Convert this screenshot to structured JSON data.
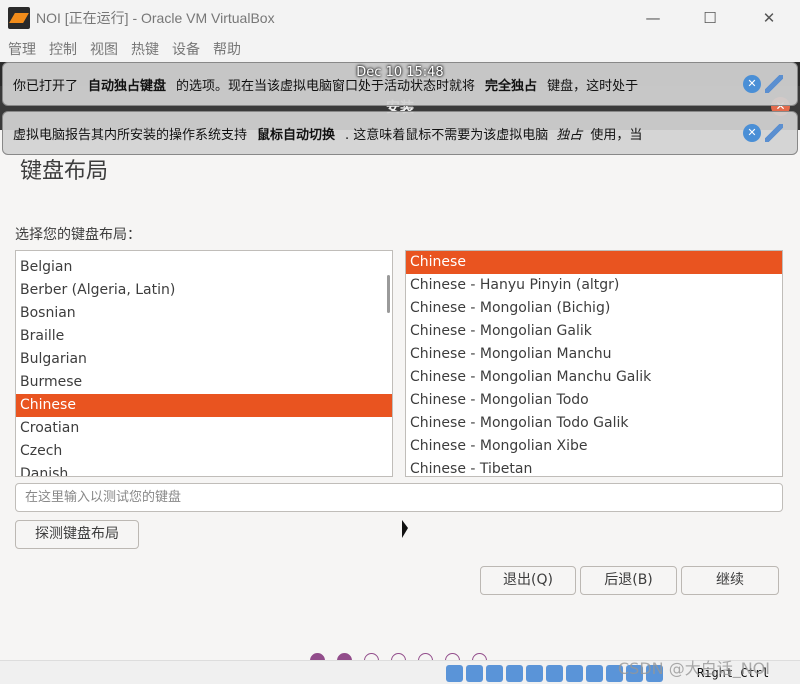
{
  "window": {
    "title": "NOI [正在运行] - Oracle VM VirtualBox",
    "minimize": "—",
    "maximize": "☐",
    "close": "✕"
  },
  "menu": [
    "管理",
    "控制",
    "视图",
    "热键",
    "设备",
    "帮助"
  ],
  "guest": {
    "clock": "Dec 10  15:48",
    "installer_title": "安装"
  },
  "notifications": [
    {
      "pre": "你已打开了",
      "bold": "自动独占键盘",
      "mid": "的选项。现在当该虚拟电脑窗口处于活动状态时就将",
      "bold2": "完全独占",
      "post": "键盘，这时处于"
    },
    {
      "pre": "虚拟电脑报告其内所安装的操作系统支持",
      "bold": "鼠标自动切换",
      "mid": ". 这意味着鼠标不需要为该虚拟电脑",
      "italic": "独占",
      "post": "使用，当"
    }
  ],
  "page": {
    "title": "键盘布局",
    "prompt": "选择您的键盘布局："
  },
  "layouts": [
    "Belgian",
    "Berber (Algeria, Latin)",
    "Bosnian",
    "Braille",
    "Bulgarian",
    "Burmese",
    "Chinese",
    "Croatian",
    "Czech",
    "Danish"
  ],
  "selected_layout": "Chinese",
  "variants": [
    "Chinese",
    "Chinese - Hanyu Pinyin (altgr)",
    "Chinese - Mongolian (Bichig)",
    "Chinese - Mongolian Galik",
    "Chinese - Mongolian Manchu",
    "Chinese - Mongolian Manchu Galik",
    "Chinese - Mongolian Todo",
    "Chinese - Mongolian Todo Galik",
    "Chinese - Mongolian Xibe",
    "Chinese - Tibetan"
  ],
  "selected_variant": "Chinese",
  "test_input": {
    "placeholder": "在这里输入以测试您的键盘",
    "value": ""
  },
  "buttons": {
    "detect": "探测键盘布局",
    "quit": "退出(Q)",
    "back": "后退(B)",
    "continue": "继续"
  },
  "progress": {
    "step": 2,
    "total": 7
  },
  "statusbar": {
    "host_key": "Right Ctrl"
  },
  "watermark": "CSDN @大白话_NOI",
  "colors": {
    "accent": "#e95420",
    "dots": "#924d8b"
  }
}
